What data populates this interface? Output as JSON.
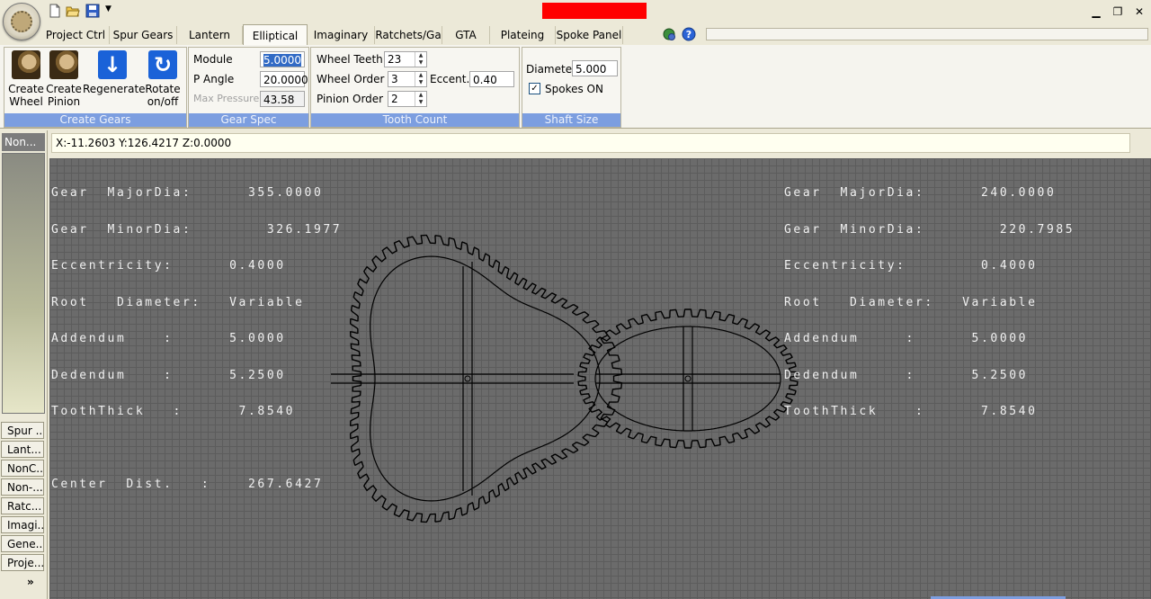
{
  "tabs": [
    {
      "label": "Project Ctrl"
    },
    {
      "label": "Spur Gears"
    },
    {
      "label": "Lantern"
    },
    {
      "label": "Elliptical"
    },
    {
      "label": "Imaginary"
    },
    {
      "label": "Ratchets/Ga"
    },
    {
      "label": "GTA"
    },
    {
      "label": "Plateing"
    },
    {
      "label": "Spoke Panel"
    }
  ],
  "ribbon": {
    "create_gears": {
      "label": "Create Gears",
      "create_wheel": "Create\nWheel",
      "create_pinion": "Create\nPinion",
      "regenerate": "Regenerate",
      "rotate": "Rotate\non/off"
    },
    "gear_spec": {
      "label": "Gear Spec",
      "module_label": "Module",
      "module_value": "5.0000",
      "p_angle_label": "P Angle",
      "p_angle_value": "20.0000",
      "max_pressure_label": "Max Pressure",
      "max_pressure_value": "43.58"
    },
    "tooth_count": {
      "label": "Tooth Count",
      "wheel_teeth_label": "Wheel Teeth",
      "wheel_teeth_value": "23",
      "wheel_order_label": "Wheel Order",
      "wheel_order_value": "3",
      "eccent_label": "Eccent.",
      "eccent_value": "0.40",
      "pinion_order_label": "Pinion Order",
      "pinion_order_value": "2"
    },
    "shaft_size": {
      "label": "Shaft Size",
      "diameter_label": "Diameter",
      "diameter_value": "5.000",
      "spokes_label": "Spokes ON",
      "spokes_checked": true
    }
  },
  "left_dock": {
    "title": "Non...",
    "tabs": [
      "Spur ...",
      "Lant...",
      "NonC...",
      "Non-...",
      "Ratc...",
      "Imagi...",
      "Gene...",
      "Proje..."
    ],
    "more": "»"
  },
  "coordinates": "X:-11.2603 Y:126.4217 Z:0.0000",
  "wheel_info": {
    "major_dia": "Gear  MajorDia:      355.0000",
    "minor_dia": "Gear  MinorDia:        326.1977",
    "eccentricity": "Eccentricity:      0.4000",
    "root_diameter": "Root   Diameter:   Variable",
    "addendum": "Addendum    :      5.0000",
    "dedendum": "Dedendum    :      5.2500",
    "tooth_thick": "ToothThick   :      7.8540",
    "center_dist": "Center  Dist.   :    267.6427"
  },
  "pinion_info": {
    "major_dia": "Gear  MajorDia:      240.0000",
    "minor_dia": "Gear  MinorDia:        220.7985",
    "eccentricity": "Eccentricity:        0.4000",
    "root_diameter": "Root   Diameter:   Variable",
    "addendum": "Addendum     :      5.0000",
    "dedendum": "Dedendum     :      5.2500",
    "tooth_thick": "ToothThick    :      7.8540"
  },
  "icons": {
    "app": "gear-logo-icon",
    "new": "new-file-icon",
    "open": "open-folder-icon",
    "save": "save-disk-icon",
    "help": "help-icon",
    "network": "network-icon"
  },
  "colors": {
    "ribbon_group_label": "#7c9ee0",
    "canvas": "#6b6b6b",
    "status_red": "#ff0000"
  }
}
